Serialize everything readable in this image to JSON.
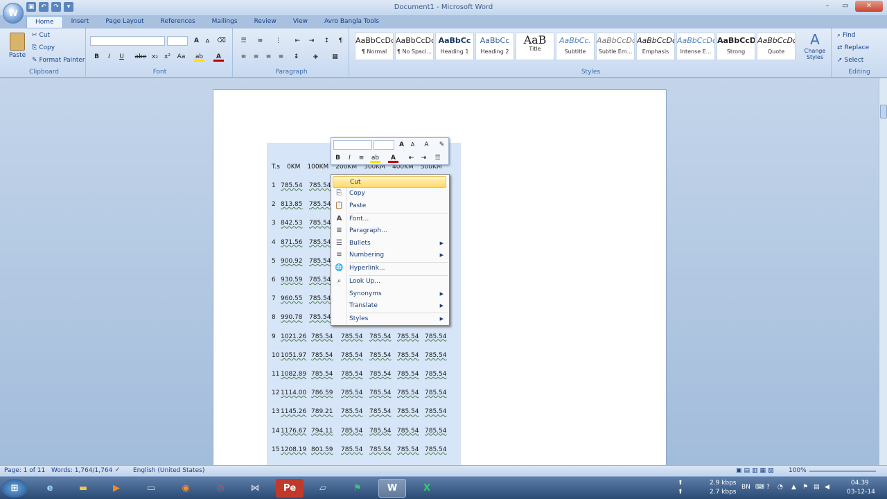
{
  "window": {
    "title": "Document1 - Microsoft Word"
  },
  "tabs": [
    "Home",
    "Insert",
    "Page Layout",
    "References",
    "Mailings",
    "Review",
    "View",
    "Avro Bangla Tools"
  ],
  "clipboard": {
    "paste": "Paste",
    "cut": "Cut",
    "copy": "Copy",
    "format_painter": "Format Painter",
    "label": "Clipboard"
  },
  "font": {
    "label": "Font",
    "bold": "B",
    "italic": "I",
    "underline": "U",
    "strike": "abe",
    "sub": "x₂",
    "sup": "x²",
    "case": "Aa",
    "grow": "A",
    "shrink": "A"
  },
  "paragraph": {
    "label": "Paragraph",
    "show_marks": "¶"
  },
  "styles": {
    "label": "Styles",
    "items": [
      {
        "preview": "AaBbCcDc",
        "name": "¶ Normal"
      },
      {
        "preview": "AaBbCcDc",
        "name": "¶ No Spaci..."
      },
      {
        "preview": "AaBbCc",
        "name": "Heading 1"
      },
      {
        "preview": "AaBbCc",
        "name": "Heading 2"
      },
      {
        "preview": "AaB",
        "name": "Title"
      },
      {
        "preview": "AaBbCc.",
        "name": "Subtitle"
      },
      {
        "preview": "AaBbCcDc",
        "name": "Subtle Em..."
      },
      {
        "preview": "AaBbCcDc",
        "name": "Emphasis"
      },
      {
        "preview": "AaBbCcDc",
        "name": "Intense E..."
      },
      {
        "preview": "AaBbCcDc",
        "name": "Strong"
      },
      {
        "preview": "AaBbCcDc",
        "name": "Quote"
      }
    ],
    "change_styles": "Change Styles"
  },
  "editing": {
    "label": "Editing",
    "find": "Find",
    "replace": "Replace",
    "select": "Select"
  },
  "table": {
    "headers": [
      "T.s",
      "0KM",
      "100KM",
      "200KM",
      "300KM",
      "400KM",
      "500KM"
    ],
    "rows": [
      [
        "1",
        "785.54",
        "785.54"
      ],
      [
        "2",
        "813.85",
        "785.54"
      ],
      [
        "3",
        "842.53",
        "785.54"
      ],
      [
        "4",
        "871.56",
        "785.54"
      ],
      [
        "5",
        "900.92",
        "785.54"
      ],
      [
        "6",
        "930.59",
        "785.54"
      ],
      [
        "7",
        "960.55",
        "785.54"
      ],
      [
        "8",
        "990.78",
        "785.54"
      ],
      [
        "9",
        "1021.26",
        "785.54",
        "785.54",
        "785.54",
        "785.54",
        "785.54"
      ],
      [
        "10",
        "1051.97",
        "785.54",
        "785.54",
        "785.54",
        "785.54",
        "785.54"
      ],
      [
        "11",
        "1082.89",
        "785.54",
        "785.54",
        "785.54",
        "785.54",
        "785.54"
      ],
      [
        "12",
        "1114.00",
        "786.59",
        "785.54",
        "785.54",
        "785.54",
        "785.54"
      ],
      [
        "13",
        "1145.26",
        "789.21",
        "785.54",
        "785.54",
        "785.54",
        "785.54"
      ],
      [
        "14",
        "1176.67",
        "794.11",
        "785.54",
        "785.54",
        "785.54",
        "785.54"
      ],
      [
        "15",
        "1208.19",
        "801.59",
        "785.54",
        "785.54",
        "785.54",
        "785.54"
      ]
    ]
  },
  "context_menu": [
    {
      "label": "Cut",
      "icon": "scissors-icon",
      "highlighted": true
    },
    {
      "label": "Copy",
      "icon": "copy-icon"
    },
    {
      "label": "Paste",
      "icon": "paste-icon"
    },
    {
      "label": "Font...",
      "icon": "font-icon"
    },
    {
      "label": "Paragraph...",
      "icon": "paragraph-icon"
    },
    {
      "label": "Bullets",
      "icon": "bullets-icon",
      "submenu": true
    },
    {
      "label": "Numbering",
      "icon": "numbering-icon",
      "submenu": true
    },
    {
      "label": "Hyperlink...",
      "icon": "hyperlink-icon"
    },
    {
      "label": "Look Up...",
      "icon": "lookup-icon"
    },
    {
      "label": "Synonyms",
      "submenu": true
    },
    {
      "label": "Translate",
      "submenu": true
    },
    {
      "label": "Styles",
      "submenu": true
    }
  ],
  "status": {
    "page": "Page: 1 of 11",
    "words": "Words: 1,764/1,764",
    "language": "English (United States)",
    "zoom": "100%"
  },
  "tray": {
    "up_speed": "2.9 kbps",
    "down_speed": "2.7 kbps",
    "lang": "BN",
    "time": "04.39",
    "date": "03-12-14"
  },
  "colors": {
    "ribbon": "#c7d9f0",
    "selection": "#b4cff1",
    "highlight": "#ffd969"
  }
}
